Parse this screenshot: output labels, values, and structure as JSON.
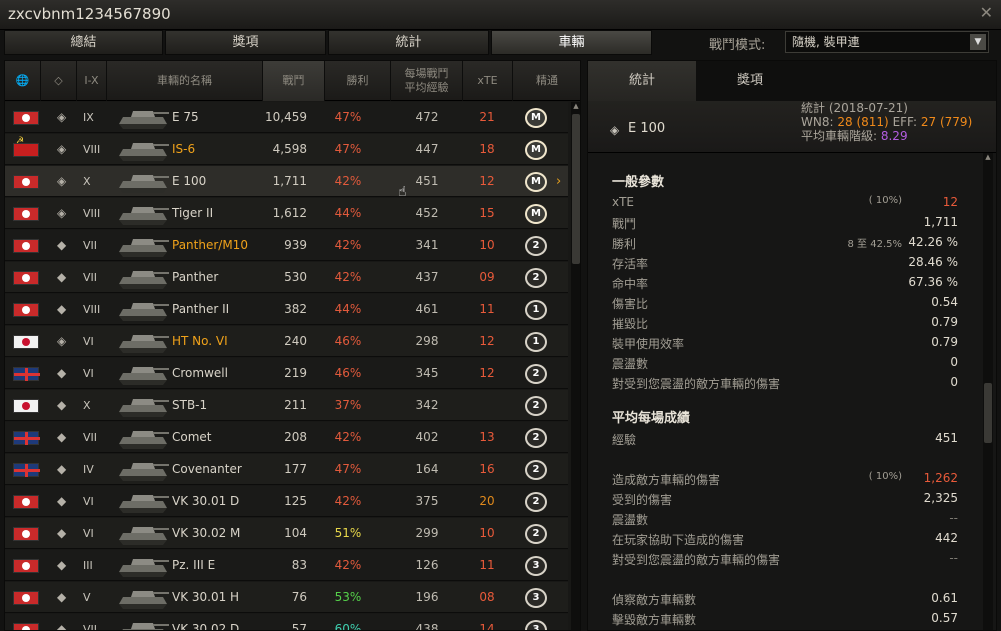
{
  "window": {
    "title": "zxcvbnm1234567890"
  },
  "tabs": [
    "總結",
    "獎項",
    "統計",
    "車輛"
  ],
  "battle_mode": {
    "label": "戰鬥模式:",
    "value": "隨機, 裝甲連"
  },
  "table": {
    "headers": {
      "nation": "🌐",
      "class": "◇",
      "tier": "I-X",
      "name": "車輛的名稱",
      "battles": "戰鬥",
      "winrate": "勝利",
      "avgxp": "每場戰鬥\n平均經驗",
      "xte": "xTE",
      "mastery": "精通"
    },
    "rows": [
      {
        "nation": "de",
        "cls": "◈",
        "tier": "IX",
        "name": "E 75",
        "battles": "10,459",
        "wr": "47%",
        "wrc": "#e25a3c",
        "xp": "472",
        "xte": "21",
        "xtec": "#e85a3a",
        "m": "M",
        "prem": false
      },
      {
        "nation": "ussr",
        "cls": "◈",
        "tier": "VIII",
        "name": "IS-6",
        "battles": "4,598",
        "wr": "47%",
        "wrc": "#e25a3c",
        "xp": "447",
        "xte": "18",
        "xtec": "#e85a3a",
        "m": "M",
        "prem": true
      },
      {
        "nation": "de",
        "cls": "◈",
        "tier": "X",
        "name": "E 100",
        "battles": "1,711",
        "wr": "42%",
        "wrc": "#e25a3c",
        "xp": "451",
        "xte": "12",
        "xtec": "#e85a3a",
        "m": "M",
        "prem": false,
        "sel": true
      },
      {
        "nation": "de",
        "cls": "◈",
        "tier": "VIII",
        "name": "Tiger II",
        "battles": "1,612",
        "wr": "44%",
        "wrc": "#e25a3c",
        "xp": "452",
        "xte": "15",
        "xtec": "#e85a3a",
        "m": "M",
        "prem": false
      },
      {
        "nation": "de",
        "cls": "◆",
        "tier": "VII",
        "name": "Panther/M10",
        "battles": "939",
        "wr": "42%",
        "wrc": "#e25a3c",
        "xp": "341",
        "xte": "10",
        "xtec": "#e85a3a",
        "m": "2",
        "prem": true
      },
      {
        "nation": "de",
        "cls": "◆",
        "tier": "VII",
        "name": "Panther",
        "battles": "530",
        "wr": "42%",
        "wrc": "#e25a3c",
        "xp": "437",
        "xte": "09",
        "xtec": "#e85a3a",
        "m": "2",
        "prem": false
      },
      {
        "nation": "de",
        "cls": "◆",
        "tier": "VIII",
        "name": "Panther II",
        "battles": "382",
        "wr": "44%",
        "wrc": "#e25a3c",
        "xp": "461",
        "xte": "11",
        "xtec": "#e85a3a",
        "m": "1",
        "prem": false
      },
      {
        "nation": "jp",
        "cls": "◈",
        "tier": "VI",
        "name": "HT No. VI",
        "battles": "240",
        "wr": "46%",
        "wrc": "#e25a3c",
        "xp": "298",
        "xte": "12",
        "xtec": "#e85a3a",
        "m": "1",
        "prem": true
      },
      {
        "nation": "uk",
        "cls": "◆",
        "tier": "VI",
        "name": "Cromwell",
        "battles": "219",
        "wr": "46%",
        "wrc": "#e25a3c",
        "xp": "345",
        "xte": "12",
        "xtec": "#e85a3a",
        "m": "2",
        "prem": false
      },
      {
        "nation": "jp",
        "cls": "◆",
        "tier": "X",
        "name": "STB-1",
        "battles": "211",
        "wr": "37%",
        "wrc": "#e25a3c",
        "xp": "342",
        "xte": "",
        "xtec": "#e85a3a",
        "m": "2",
        "prem": false
      },
      {
        "nation": "uk",
        "cls": "◆",
        "tier": "VII",
        "name": "Comet",
        "battles": "208",
        "wr": "42%",
        "wrc": "#e25a3c",
        "xp": "402",
        "xte": "13",
        "xtec": "#e85a3a",
        "m": "2",
        "prem": false
      },
      {
        "nation": "uk",
        "cls": "◆",
        "tier": "IV",
        "name": "Covenanter",
        "battles": "177",
        "wr": "47%",
        "wrc": "#e25a3c",
        "xp": "164",
        "xte": "16",
        "xtec": "#e85a3a",
        "m": "2",
        "prem": false
      },
      {
        "nation": "de",
        "cls": "◆",
        "tier": "VI",
        "name": "VK 30.01 D",
        "battles": "125",
        "wr": "42%",
        "wrc": "#e25a3c",
        "xp": "375",
        "xte": "20",
        "xtec": "#e08a1c",
        "m": "2",
        "prem": false
      },
      {
        "nation": "de",
        "cls": "◆",
        "tier": "VI",
        "name": "VK 30.02 M",
        "battles": "104",
        "wr": "51%",
        "wrc": "#e8d84a",
        "xp": "299",
        "xte": "10",
        "xtec": "#e85a3a",
        "m": "2",
        "prem": false
      },
      {
        "nation": "de",
        "cls": "◆",
        "tier": "III",
        "name": "Pz. III E",
        "battles": "83",
        "wr": "42%",
        "wrc": "#e25a3c",
        "xp": "126",
        "xte": "11",
        "xtec": "#e85a3a",
        "m": "3",
        "prem": false
      },
      {
        "nation": "de",
        "cls": "◆",
        "tier": "V",
        "name": "VK 30.01 H",
        "battles": "76",
        "wr": "53%",
        "wrc": "#55d04a",
        "xp": "196",
        "xte": "08",
        "xtec": "#e85a3a",
        "m": "3",
        "prem": false
      },
      {
        "nation": "de",
        "cls": "◆",
        "tier": "VII",
        "name": "VK 30.02 D",
        "battles": "57",
        "wr": "60%",
        "wrc": "#3fd0b0",
        "xp": "438",
        "xte": "14",
        "xtec": "#e85a3a",
        "m": "3",
        "prem": false
      }
    ]
  },
  "panel": {
    "tabs": [
      "統計",
      "獎項"
    ],
    "vehicle": {
      "icon": "◈",
      "name": "E 100"
    },
    "stats_header": {
      "l1": "統計 (2018-07-21)",
      "wn8_label": "WN8: ",
      "wn8": "28",
      "wn8_paren": "(811)",
      "eff_label": "EFF: ",
      "eff": "27",
      "eff_paren": "(779)",
      "avg_tier_label": "平均車輛階級: ",
      "avg_tier": "8.29"
    },
    "sections": [
      {
        "title": "一般參數",
        "rows": [
          {
            "k": "xTE",
            "extra": "( 10%)",
            "v": "12",
            "vc": "#e85a3a"
          },
          {
            "k": "戰鬥",
            "v": "1,711"
          },
          {
            "k": "勝利",
            "extra_hl": "8 至 42.5%",
            "v": "42.26 %"
          },
          {
            "k": "存活率",
            "v": "28.46 %"
          },
          {
            "k": "命中率",
            "v": "67.36 %"
          },
          {
            "k": "傷害比",
            "v": "0.54"
          },
          {
            "k": "摧毀比",
            "v": "0.79"
          },
          {
            "k": "裝甲使用效率",
            "v": "0.79"
          },
          {
            "k": "震盪數",
            "v": "0"
          },
          {
            "k": "對受到您震盪的敵方車輛的傷害",
            "v": "0"
          }
        ]
      },
      {
        "title": "平均每場成績",
        "rows": [
          {
            "k": "經驗",
            "v": "451"
          },
          {
            "k": "",
            "v": ""
          },
          {
            "k": "造成敵方車輛的傷害",
            "extra": "( 10%)",
            "v": "1,262",
            "vc": "#e85a3a"
          },
          {
            "k": "受到的傷害",
            "v": "2,325"
          },
          {
            "k": "震盪數",
            "v": "--",
            "vc": "#7d7a72"
          },
          {
            "k": "在玩家協助下造成的傷害",
            "v": "442"
          },
          {
            "k": "對受到您震盪的敵方車輛的傷害",
            "v": "--",
            "vc": "#7d7a72"
          },
          {
            "k": "",
            "v": ""
          },
          {
            "k": "偵察敵方車輛數",
            "v": "0.61"
          },
          {
            "k": "擊毀敵方車輛數",
            "v": "0.57"
          }
        ]
      }
    ]
  }
}
